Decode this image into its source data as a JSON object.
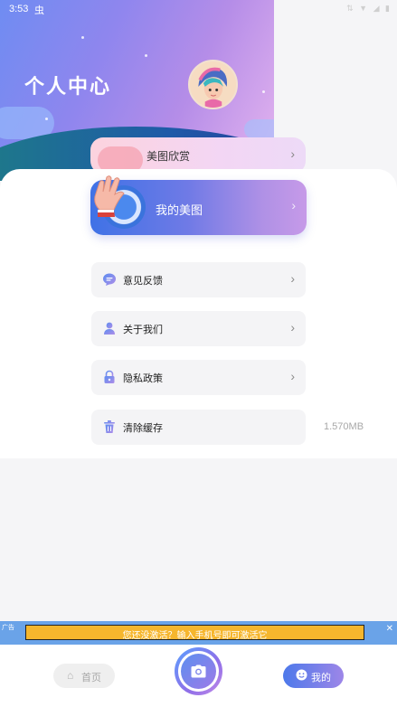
{
  "status_bar": {
    "time": "3:53",
    "bug_glyph": "虫",
    "icons": [
      "debug-icon",
      "data-icon",
      "wifi-icon",
      "signal-icon",
      "battery-icon"
    ]
  },
  "header": {
    "title": "个人中心",
    "avatar": "avatar-illustration"
  },
  "tabs": {
    "back_label": "美图欣赏",
    "front_label": "我的美图"
  },
  "menu": [
    {
      "label": "意见反馈",
      "icon": "chat-bubble-icon"
    },
    {
      "label": "关于我们",
      "icon": "user-icon"
    },
    {
      "label": "隐私政策",
      "icon": "lock-icon"
    },
    {
      "label": "清除缓存",
      "icon": "trash-icon",
      "value": "1.570MB"
    }
  ],
  "ad": {
    "text": "您还没激活？输入手机号即可激活它",
    "tag": "广告"
  },
  "bottom_nav": {
    "home_label": "首页",
    "mine_label": "我的",
    "camera_icon": "camera-icon"
  },
  "colors": {
    "accent_blue": "#4d79ea",
    "accent_purple": "#b58de8",
    "ad_yellow": "#f6b62d",
    "ad_blue": "#6aa3e8"
  }
}
